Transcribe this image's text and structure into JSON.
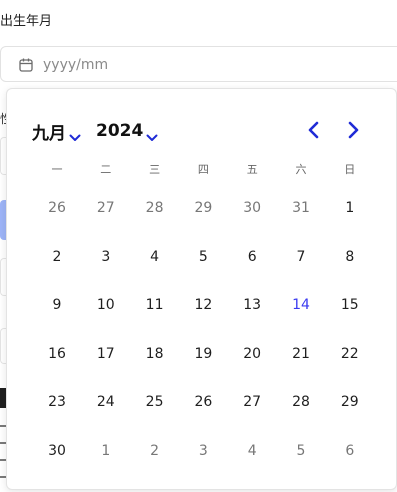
{
  "form": {
    "birth_label": "出生年月",
    "date_placeholder": "yyyy/mm"
  },
  "background_fragments": {
    "label_glyph": "性"
  },
  "calendar": {
    "month_label": "九月",
    "year_label": "2024",
    "accent_color": "#1f2bd6",
    "today_color": "#3a3af0",
    "weekdays": [
      "一",
      "二",
      "三",
      "四",
      "五",
      "六",
      "日"
    ],
    "weeks": [
      [
        {
          "d": "26",
          "m": true
        },
        {
          "d": "27",
          "m": true
        },
        {
          "d": "28",
          "m": true
        },
        {
          "d": "29",
          "m": true
        },
        {
          "d": "30",
          "m": true
        },
        {
          "d": "31",
          "m": true
        },
        {
          "d": "1",
          "m": false
        }
      ],
      [
        {
          "d": "2",
          "m": false
        },
        {
          "d": "3",
          "m": false
        },
        {
          "d": "4",
          "m": false
        },
        {
          "d": "5",
          "m": false
        },
        {
          "d": "6",
          "m": false
        },
        {
          "d": "7",
          "m": false
        },
        {
          "d": "8",
          "m": false
        }
      ],
      [
        {
          "d": "9",
          "m": false
        },
        {
          "d": "10",
          "m": false
        },
        {
          "d": "11",
          "m": false
        },
        {
          "d": "12",
          "m": false
        },
        {
          "d": "13",
          "m": false
        },
        {
          "d": "14",
          "m": false,
          "today": true
        },
        {
          "d": "15",
          "m": false
        }
      ],
      [
        {
          "d": "16",
          "m": false
        },
        {
          "d": "17",
          "m": false
        },
        {
          "d": "18",
          "m": false
        },
        {
          "d": "19",
          "m": false
        },
        {
          "d": "20",
          "m": false
        },
        {
          "d": "21",
          "m": false
        },
        {
          "d": "22",
          "m": false
        }
      ],
      [
        {
          "d": "23",
          "m": false
        },
        {
          "d": "24",
          "m": false
        },
        {
          "d": "25",
          "m": false
        },
        {
          "d": "26",
          "m": false
        },
        {
          "d": "27",
          "m": false
        },
        {
          "d": "28",
          "m": false
        },
        {
          "d": "29",
          "m": false
        }
      ],
      [
        {
          "d": "30",
          "m": false
        },
        {
          "d": "1",
          "m": true
        },
        {
          "d": "2",
          "m": true
        },
        {
          "d": "3",
          "m": true
        },
        {
          "d": "4",
          "m": true
        },
        {
          "d": "5",
          "m": true
        },
        {
          "d": "6",
          "m": true
        }
      ]
    ]
  }
}
